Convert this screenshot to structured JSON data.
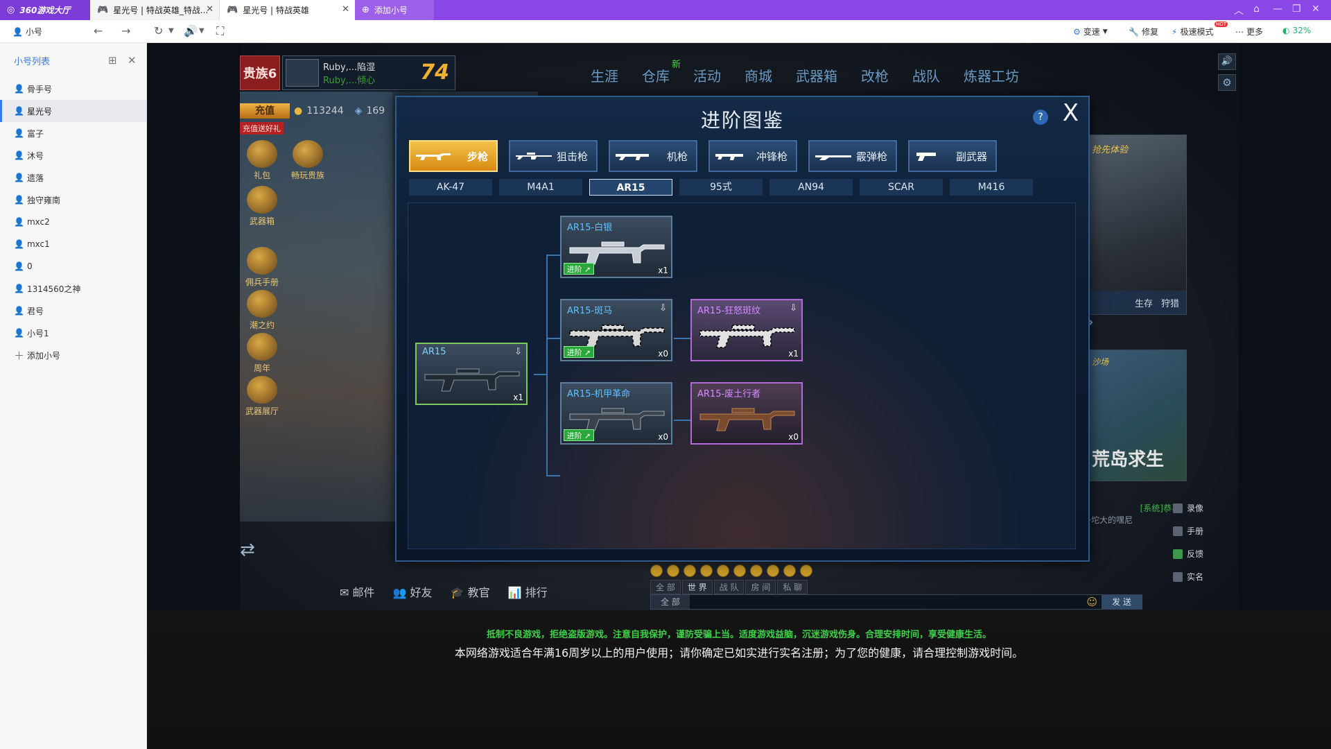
{
  "tabs": {
    "home": "360游戏大厅",
    "tab1": "星光号 | 特战英雄_特战...",
    "tab2": "星光号 | 特战英雄",
    "add": "添加小号"
  },
  "toolbar": {
    "account": "小号",
    "speed": "变速",
    "repair": "修复",
    "turbo": "极速模式",
    "turbo_badge": "HOT",
    "more": "更多",
    "percent": "32%"
  },
  "sidebar": {
    "title": "小号列表",
    "items": [
      "骨手号",
      "星光号",
      "富子",
      "沐号",
      "遗落",
      "独守雍南",
      "mxc2",
      "mxc1",
      "0",
      "1314560之神",
      "君号",
      "小号1"
    ],
    "add": "添加小号"
  },
  "game": {
    "vip": "贵族6",
    "player_name1": "Ruby,...陷湿",
    "player_name2": "Ruby,...倾心",
    "level": "74",
    "nav": [
      "生涯",
      "仓库",
      "活动",
      "商城",
      "武器箱",
      "改枪",
      "战队",
      "炼器工坊"
    ],
    "nav_new": "新",
    "recharge": "充值",
    "coins": "113244",
    "coins2": "169",
    "gift_tag": "充值送好礼",
    "left_icons": [
      "礼包",
      "畅玩贵族",
      "武器箱",
      "佣兵手册",
      "潮之约",
      "周年",
      "武器展厅"
    ],
    "links": [
      "邮件",
      "好友",
      "教官",
      "排行"
    ],
    "chat_tabs": [
      "全 部",
      "世 界",
      "战 队",
      "房 间",
      "私 聊"
    ],
    "chat_scope": "全 部",
    "send": "发 送",
    "right_panel1_label": "抢先体验",
    "right_panel1_tags": [
      "生存",
      "狩猎"
    ],
    "right_panel2_top": "沙场",
    "right_panel2_big": "荒岛求生",
    "sys_msg1": "[系统]恭喜",
    "sys_msg2": "一坨大的嘿尼",
    "right_links": [
      "录像",
      "手册",
      "反馈",
      "实名"
    ],
    "notice1": "抵制不良游戏，拒绝盗版游戏。注意自我保护，谨防受骗上当。适度游戏益脑，沉迷游戏伤身。合理安排时间，享受健康生活。",
    "notice2": "本网络游戏适合年满16周岁以上的用户使用；请你确定已如实进行实名注册；为了您的健康，请合理控制游戏时间。"
  },
  "modal": {
    "title": "进阶图鉴",
    "help": "?",
    "close": "X",
    "categories": [
      "步枪",
      "狙击枪",
      "机枪",
      "冲锋枪",
      "霰弹枪",
      "副武器"
    ],
    "subs": [
      "AK-47",
      "M4A1",
      "AR15",
      "95式",
      "AN94",
      "SCAR",
      "M416"
    ],
    "advance_label": "进阶",
    "cards": {
      "base": {
        "name": "AR15",
        "qty": "x1"
      },
      "silver": {
        "name": "AR15-白银",
        "qty": "x1"
      },
      "zebra": {
        "name": "AR15-斑马",
        "qty": "x0"
      },
      "mecha": {
        "name": "AR15-机甲革命",
        "qty": "x0"
      },
      "wild": {
        "name": "AR15-狂怒斑纹",
        "qty": "x1"
      },
      "waste": {
        "name": "AR15-废土行者",
        "qty": "x0"
      }
    }
  }
}
